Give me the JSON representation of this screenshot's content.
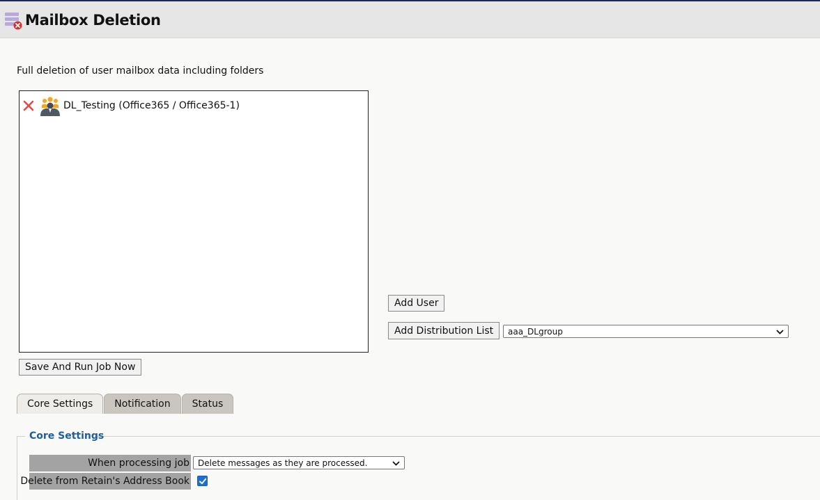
{
  "header": {
    "title": "Mailbox Deletion",
    "icon": "mailbox-delete-icon"
  },
  "description": "Full deletion of user mailbox data including folders",
  "member_list": {
    "items": [
      {
        "label": "DL_Testing (Office365 / Office365-1)",
        "icon": "group-icon",
        "remove_icon": "remove-x-icon"
      }
    ]
  },
  "actions": {
    "add_user_label": "Add User",
    "add_distribution_list_label": "Add Distribution List",
    "distribution_list_selected": "aaa_DLgroup",
    "save_and_run_label": "Save And Run Job Now"
  },
  "tabs": [
    {
      "label": "Core Settings",
      "active": true
    },
    {
      "label": "Notification",
      "active": false
    },
    {
      "label": "Status",
      "active": false
    }
  ],
  "core_settings": {
    "legend": "Core Settings",
    "when_processing_label": "When processing job",
    "when_processing_value": "Delete messages as they are processed.",
    "delete_address_book_label": "Delete from Retain's Address Book",
    "delete_address_book_checked": true
  },
  "colors": {
    "header_bg": "#e6e6e6",
    "legend_blue": "#1f5d9e",
    "label_bg": "#a3a3a3",
    "checkbox_blue": "#1f6fd1",
    "remove_red": "#e24a4a",
    "group_orange": "#f5a623"
  }
}
